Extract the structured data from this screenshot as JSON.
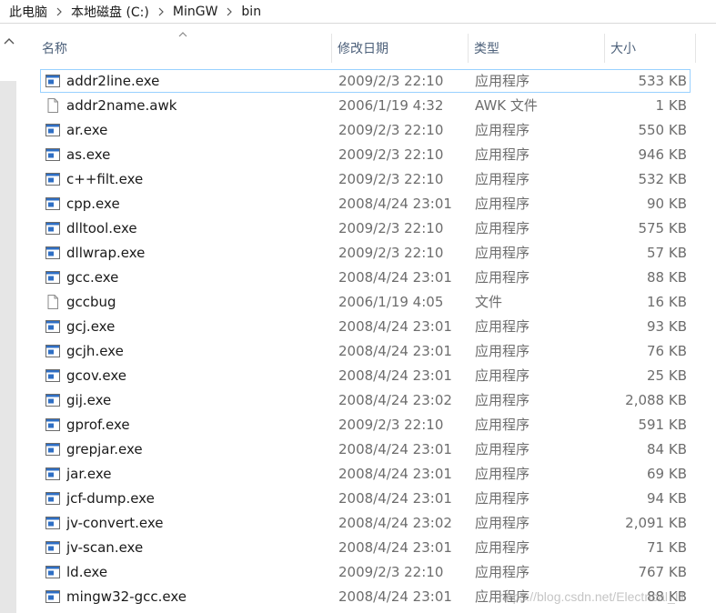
{
  "breadcrumb": {
    "items": [
      "此电脑",
      "本地磁盘 (C:)",
      "MinGW",
      "bin"
    ]
  },
  "columns": {
    "name": "名称",
    "date": "修改日期",
    "type": "类型",
    "size": "大小"
  },
  "files": [
    {
      "name": "addr2line.exe",
      "date": "2009/2/3 22:10",
      "type": "应用程序",
      "size": "533 KB",
      "icon": "exe-icon",
      "selected": true
    },
    {
      "name": "addr2name.awk",
      "date": "2006/1/19 4:32",
      "type": "AWK 文件",
      "size": "1 KB",
      "icon": "file-icon"
    },
    {
      "name": "ar.exe",
      "date": "2009/2/3 22:10",
      "type": "应用程序",
      "size": "550 KB",
      "icon": "exe-icon"
    },
    {
      "name": "as.exe",
      "date": "2009/2/3 22:10",
      "type": "应用程序",
      "size": "946 KB",
      "icon": "exe-icon"
    },
    {
      "name": "c++filt.exe",
      "date": "2009/2/3 22:10",
      "type": "应用程序",
      "size": "532 KB",
      "icon": "exe-icon"
    },
    {
      "name": "cpp.exe",
      "date": "2008/4/24 23:01",
      "type": "应用程序",
      "size": "90 KB",
      "icon": "exe-icon"
    },
    {
      "name": "dlltool.exe",
      "date": "2009/2/3 22:10",
      "type": "应用程序",
      "size": "575 KB",
      "icon": "exe-icon"
    },
    {
      "name": "dllwrap.exe",
      "date": "2009/2/3 22:10",
      "type": "应用程序",
      "size": "57 KB",
      "icon": "exe-icon"
    },
    {
      "name": "gcc.exe",
      "date": "2008/4/24 23:01",
      "type": "应用程序",
      "size": "88 KB",
      "icon": "exe-icon"
    },
    {
      "name": "gccbug",
      "date": "2006/1/19 4:05",
      "type": "文件",
      "size": "16 KB",
      "icon": "file-icon"
    },
    {
      "name": "gcj.exe",
      "date": "2008/4/24 23:01",
      "type": "应用程序",
      "size": "93 KB",
      "icon": "exe-icon"
    },
    {
      "name": "gcjh.exe",
      "date": "2008/4/24 23:01",
      "type": "应用程序",
      "size": "76 KB",
      "icon": "exe-icon"
    },
    {
      "name": "gcov.exe",
      "date": "2008/4/24 23:01",
      "type": "应用程序",
      "size": "25 KB",
      "icon": "exe-icon"
    },
    {
      "name": "gij.exe",
      "date": "2008/4/24 23:02",
      "type": "应用程序",
      "size": "2,088 KB",
      "icon": "exe-icon"
    },
    {
      "name": "gprof.exe",
      "date": "2009/2/3 22:10",
      "type": "应用程序",
      "size": "591 KB",
      "icon": "exe-icon"
    },
    {
      "name": "grepjar.exe",
      "date": "2008/4/24 23:01",
      "type": "应用程序",
      "size": "84 KB",
      "icon": "exe-icon"
    },
    {
      "name": "jar.exe",
      "date": "2008/4/24 23:01",
      "type": "应用程序",
      "size": "69 KB",
      "icon": "exe-icon"
    },
    {
      "name": "jcf-dump.exe",
      "date": "2008/4/24 23:01",
      "type": "应用程序",
      "size": "94 KB",
      "icon": "exe-icon"
    },
    {
      "name": "jv-convert.exe",
      "date": "2008/4/24 23:02",
      "type": "应用程序",
      "size": "2,091 KB",
      "icon": "exe-icon"
    },
    {
      "name": "jv-scan.exe",
      "date": "2008/4/24 23:01",
      "type": "应用程序",
      "size": "71 KB",
      "icon": "exe-icon"
    },
    {
      "name": "ld.exe",
      "date": "2009/2/3 22:10",
      "type": "应用程序",
      "size": "767 KB",
      "icon": "exe-icon"
    },
    {
      "name": "mingw32-gcc.exe",
      "date": "2008/4/24 23:01",
      "type": "应用程序",
      "size": "88 KB",
      "icon": "exe-icon"
    }
  ],
  "watermark": "https://blog.csdn.net/Electrical_IT",
  "colors": {
    "selection_border": "#99d1ff",
    "header_text": "#4c607a",
    "exe_icon_blue": "#2f6fc4"
  }
}
